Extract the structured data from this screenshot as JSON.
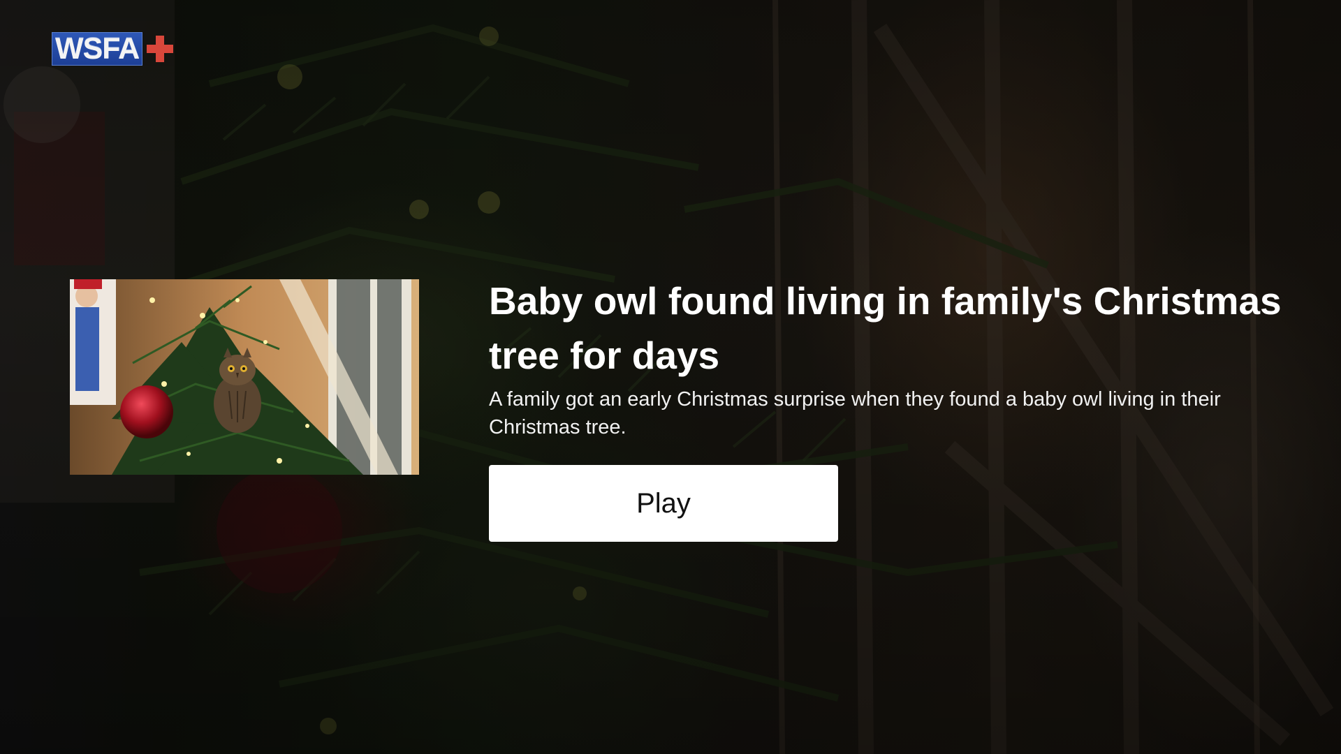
{
  "app": {
    "logo": {
      "text": "WSFA",
      "accent": "+",
      "colors": {
        "box": "#2446a6",
        "text": "#f4f4f4",
        "plus": "#d8473b"
      }
    }
  },
  "video": {
    "title": "Baby owl found living in family's Christmas tree for days",
    "description": "A family got an early Christmas surprise when they found a baby owl living in their Christmas tree.",
    "thumbnail_icon": "owl-in-christmas-tree-photo",
    "play_label": "Play"
  },
  "colors": {
    "background": "#0c0b0a",
    "title_text": "#ffffff",
    "button_bg": "#ffffff",
    "button_text": "#111111"
  }
}
